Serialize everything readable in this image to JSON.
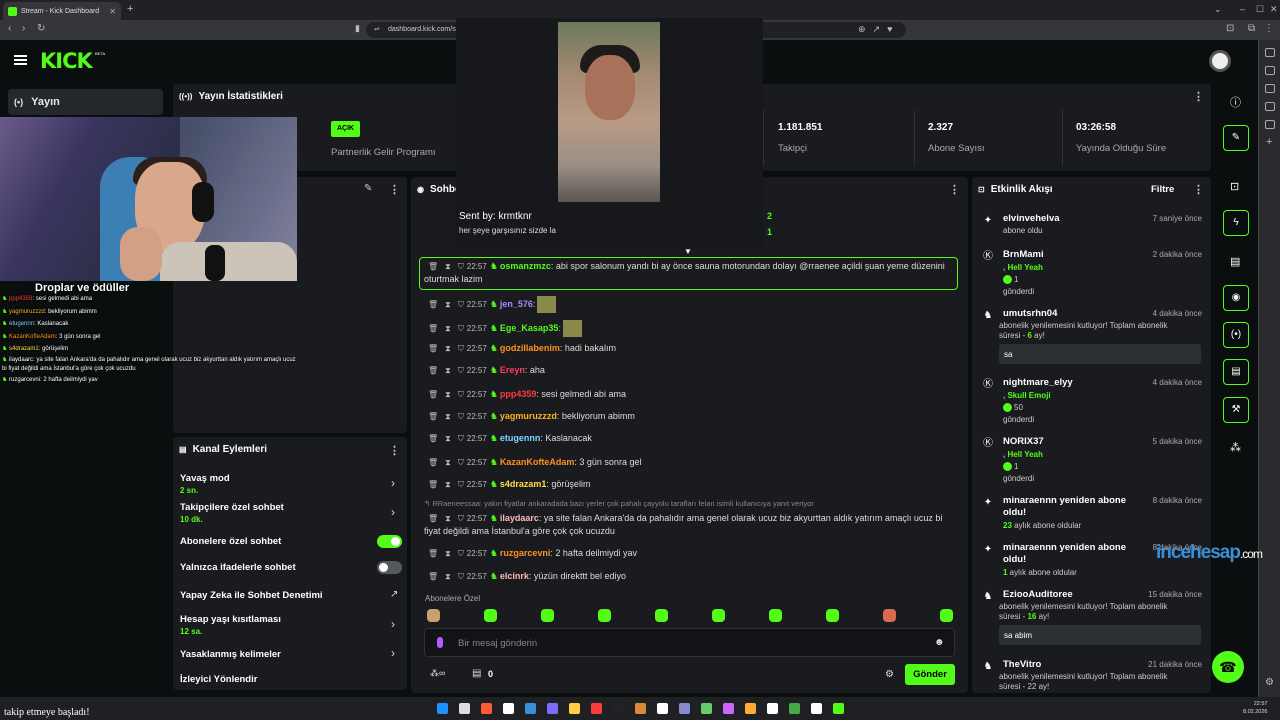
{
  "browser": {
    "tab_title": "Stream - Kick Dashboard",
    "url": "dashboard.kick.com/s"
  },
  "brand": {
    "logo": "KICK",
    "beta": "BETA",
    "accent": "#53fc18"
  },
  "nav": {
    "live_label": "Yayın"
  },
  "stats": {
    "title": "Yayın İstatistikleri",
    "partner_badge": "AÇIK",
    "partner_label": "Partnerlik Gelir Programı",
    "followers_value": "1.181.851",
    "followers_label": "Takipçi",
    "subs_value": "2.327",
    "subs_label": "Abone Sayısı",
    "uptime_value": "03:26:58",
    "uptime_label": "Yayında Olduğu Süre"
  },
  "overlay": {
    "title": "Droplar ve ödüller",
    "messages": [
      {
        "user": "ppp4359",
        "text": ": sesi gelmedi abi ama",
        "color": "#ff3c3c"
      },
      {
        "user": "yagmuruzzzd",
        "text": ": bekliyorum abimm",
        "color": "#ffb020"
      },
      {
        "user": "etugennn",
        "text": ": Kaslanacak",
        "color": "#7fd4ff"
      },
      {
        "user": "KazanKofteAdam",
        "text": ": 3 gün sonra gel",
        "color": "#ff9020"
      },
      {
        "user": "s4drazam1",
        "text": ": görüşelim",
        "color": "#ffe040"
      },
      {
        "user": "ilaydaarc",
        "text": ": ya site falan Ankara'da da pahalıdır ama genel olarak ucuz biz akyurttan aldık yatırım amaçlı ucuz bi fiyat değildi ama İstanbul'a göre çok çok ucuzdu",
        "color": "#ffffff"
      },
      {
        "user": "ruzgarcevni",
        "text": ": 2 hafta deilmiydi yav",
        "color": "#ffffff"
      }
    ]
  },
  "actions": {
    "title": "Kanal Eylemleri",
    "slow_mode": "Yavaş mod",
    "slow_mode_value": "2 sn.",
    "followers_only": "Takipçilere özel sohbet",
    "followers_only_value": "10 dk.",
    "subs_only": "Abonelere özel sohbet",
    "emotes_only": "Yalnızca ifadelerle sohbet",
    "ai_moderation": "Yapay Zeka ile Sohbet Denetimi",
    "account_age": "Hesap yaşı kısıtlaması",
    "account_age_value": "12 sa.",
    "banned_words": "Yasaklanmış kelimeler",
    "viewer_redirect": "İzleyici Yönlendir"
  },
  "chat": {
    "title": "Sohbet",
    "hidden_counts": [
      "2",
      "1"
    ],
    "messages": [
      {
        "time": "22:57",
        "user": "osmanzmzc",
        "color": "#53fc18",
        "text": ": abi spor salonum yandı bi ay önce sauna motorundan dolayı @rraenee açildi şuan yeme düzenini oturtmak lazim"
      },
      {
        "time": "22:57",
        "user": "jen_576",
        "color": "#a88aff",
        "text": ":"
      },
      {
        "time": "22:57",
        "user": "Ege_Kasap35",
        "color": "#53fc18",
        "text": ":"
      },
      {
        "time": "22:57",
        "user": "godzillabenim",
        "color": "#ff9020",
        "text": ": hadi bakalım"
      },
      {
        "time": "22:57",
        "user": "Ereyn",
        "color": "#ff3c5c",
        "text": ": aha"
      },
      {
        "time": "22:57",
        "user": "ppp4359",
        "color": "#ff3c3c",
        "text": ": sesi gelmedi abi ama"
      },
      {
        "time": "22:57",
        "user": "yagmuruzzzd",
        "color": "#ffb020",
        "text": ": bekliyorum abimm"
      },
      {
        "time": "22:57",
        "user": "etugennn",
        "color": "#7fd4ff",
        "text": ": Kaslanacak"
      },
      {
        "time": "22:57",
        "user": "KazanKofteAdam",
        "color": "#ff9020",
        "text": ": 3 gün sonra gel"
      },
      {
        "time": "22:57",
        "user": "s4drazam1",
        "color": "#ffe040",
        "text": ": görüşelim"
      },
      {
        "time": "22:57",
        "user": "ilaydaarc",
        "color": "#ffb8b8",
        "text": ": ya site falan Ankara'da da pahalıdır ama genel olarak ucuz biz akyurttan aldık yatırım amaçlı ucuz bi fiyat değildi ama İstanbul'a göre çok çok ucuzdu"
      },
      {
        "time": "22:57",
        "user": "ruzgarcevni",
        "color": "#ff9020",
        "text": ": 2 hafta deilmiydi yav"
      },
      {
        "time": "22:57",
        "user": "elcinrk",
        "color": "#ffb8b8",
        "text": ": yüzün direkttt bel ediyo"
      }
    ],
    "reply_hint": "RRaeneessaa: yakın fiyatlar ankaradada bazı yerler çok pahalı çayyolu tarafları felan isimli kullanıcıya yanıt veriyor",
    "subs_label": "Abonelere Özel",
    "input_placeholder": "Bir mesaj gönderin",
    "send_label": "Gönder",
    "bottom_count": "0"
  },
  "feed": {
    "title": "Etkinlik Akışı",
    "filter": "Filtre",
    "items": [
      {
        "name": "elvinvehelva",
        "time": "7 saniye önce",
        "sub": "abone oldu"
      },
      {
        "name": "BrnMami",
        "time": "2 dakika önce",
        "gift": ", Hell Yeah",
        "coins": "1",
        "sub": "gönderdi"
      },
      {
        "name": "umutsrhn04",
        "time": "4 dakika önce",
        "sub": "abonelik yenilemesini kutluyor! Toplam abonelik süresi - ",
        "months": "6",
        "months_suffix": " ay!",
        "msg": "sa"
      },
      {
        "name": "nightmare_elyy",
        "time": "4 dakika önce",
        "gift": ", Skull Emoji",
        "coins": "50",
        "sub": "gönderdi"
      },
      {
        "name": "NORIX37",
        "time": "5 dakika önce",
        "gift": ", Hell Yeah",
        "coins": "1",
        "sub": "gönderdi"
      },
      {
        "name": "minaraennn yeniden abone oldu!",
        "time": "8 dakika önce",
        "months": "23",
        "sub": " aylık abone oldular"
      },
      {
        "name": "minaraennn yeniden abone oldu!",
        "time": "8 dakika önce",
        "months": "1",
        "sub": " aylık abone oldular"
      },
      {
        "name": "EziooAuditoree",
        "time": "15 dakika önce",
        "sub": "abonelik yenilemesini kutluyor! Toplam abonelik süresi - ",
        "months": "16",
        "months_suffix": " ay!",
        "msg": "sa abim"
      },
      {
        "name": "TheVitro",
        "time": "21 dakika önce",
        "sub": "abonelik yenilemesini kutluyor! Toplam abonelik süresi - 22 ay!"
      }
    ]
  },
  "popup": {
    "sender": "Sent by: krmtknr",
    "message": "her şeye garşısınız sizde la"
  },
  "watermark": {
    "a": "ince",
    "b": "hesap",
    "c": ".com"
  },
  "taskbar": {
    "alert": "takip etmeye başladı!",
    "time": "22:57",
    "date": "8.02.2026"
  }
}
